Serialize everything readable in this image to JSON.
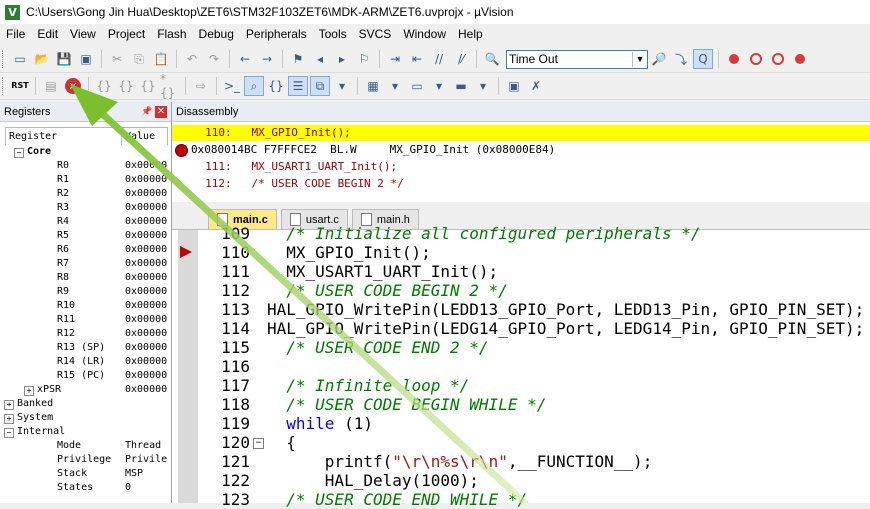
{
  "window": {
    "title": "C:\\Users\\Gong Jin Hua\\Desktop\\ZET6\\STM32F103ZET6\\MDK-ARM\\ZET6.uvprojx - µVision",
    "app_icon": "V"
  },
  "menu": [
    "File",
    "Edit",
    "View",
    "Project",
    "Flash",
    "Debug",
    "Peripherals",
    "Tools",
    "SVCS",
    "Window",
    "Help"
  ],
  "toolbar": {
    "find_value": "Time Out",
    "rst_label": "RST"
  },
  "registers": {
    "title": "Registers",
    "col_register": "Register",
    "col_value": "Value",
    "rows": [
      {
        "name": "Core",
        "value": "",
        "indent": 1,
        "expander": "−",
        "bold": true
      },
      {
        "name": "R0",
        "value": "0x00000",
        "indent": 3
      },
      {
        "name": "R1",
        "value": "0x00000",
        "indent": 3
      },
      {
        "name": "R2",
        "value": "0x00000",
        "indent": 3
      },
      {
        "name": "R3",
        "value": "0x00000",
        "indent": 3
      },
      {
        "name": "R4",
        "value": "0x00000",
        "indent": 3
      },
      {
        "name": "R5",
        "value": "0x00000",
        "indent": 3
      },
      {
        "name": "R6",
        "value": "0x00000",
        "indent": 3
      },
      {
        "name": "R7",
        "value": "0x00000",
        "indent": 3
      },
      {
        "name": "R8",
        "value": "0x00000",
        "indent": 3
      },
      {
        "name": "R9",
        "value": "0x00000",
        "indent": 3
      },
      {
        "name": "R10",
        "value": "0x00000",
        "indent": 3
      },
      {
        "name": "R11",
        "value": "0x00000",
        "indent": 3
      },
      {
        "name": "R12",
        "value": "0x00000",
        "indent": 3
      },
      {
        "name": "R13 (SP)",
        "value": "0x00000",
        "indent": 3
      },
      {
        "name": "R14 (LR)",
        "value": "0x00000",
        "indent": 3
      },
      {
        "name": "R15 (PC)",
        "value": "0x00000",
        "indent": 3
      },
      {
        "name": "xPSR",
        "value": "0x00000",
        "indent": 2,
        "expander": "+"
      },
      {
        "name": "Banked",
        "value": "",
        "indent": 0,
        "expander": "+"
      },
      {
        "name": "System",
        "value": "",
        "indent": 0,
        "expander": "+"
      },
      {
        "name": "Internal",
        "value": "",
        "indent": 0,
        "expander": "−"
      },
      {
        "name": "Mode",
        "value": "Thread",
        "indent": 3
      },
      {
        "name": "Privilege",
        "value": "Privile",
        "indent": 3
      },
      {
        "name": "Stack",
        "value": "MSP",
        "indent": 3
      },
      {
        "name": "States",
        "value": "0",
        "indent": 3
      }
    ]
  },
  "disassembly": {
    "title": "Disassembly",
    "lines": [
      {
        "text": "     110:   MX_GPIO_Init();",
        "highlight": true,
        "breakpoint": false,
        "color": "#a00000"
      },
      {
        "text": "0x080014BC F7FFFCE2  BL.W     MX_GPIO_Init (0x08000E84)",
        "highlight": false,
        "breakpoint": true,
        "color": "#000000"
      },
      {
        "text": "     111:   MX_USART1_UART_Init();",
        "highlight": false,
        "breakpoint": false,
        "color": "#a00000"
      },
      {
        "text": "     112:   /* USER CODE BEGIN 2 */",
        "highlight": false,
        "breakpoint": false,
        "color": "#a00000"
      }
    ]
  },
  "editor": {
    "tabs": [
      {
        "label": "main.c",
        "active": true
      },
      {
        "label": "usart.c",
        "active": false
      },
      {
        "label": "main.h",
        "active": false
      }
    ],
    "lines": [
      {
        "no": "109",
        "code": "  /* Initialize all configured peripherals */",
        "type": "cm"
      },
      {
        "no": "110",
        "code": "  MX_GPIO_Init();",
        "type": "plain",
        "marker": true
      },
      {
        "no": "111",
        "code": "  MX_USART1_UART_Init();",
        "type": "plain"
      },
      {
        "no": "112",
        "code": "  /* USER CODE BEGIN 2 */",
        "type": "cm"
      },
      {
        "no": "113",
        "code": "HAL_GPIO_WritePin(LEDD13_GPIO_Port, LEDD13_Pin, GPIO_PIN_SET);",
        "type": "plain"
      },
      {
        "no": "114",
        "code": "HAL_GPIO_WritePin(LEDG14_GPIO_Port, LEDG14_Pin, GPIO_PIN_SET);",
        "type": "plain"
      },
      {
        "no": "115",
        "code": "  /* USER CODE END 2 */",
        "type": "cm"
      },
      {
        "no": "116",
        "code": "",
        "type": "plain"
      },
      {
        "no": "117",
        "code": "  /* Infinite loop */",
        "type": "cm"
      },
      {
        "no": "118",
        "code": "  /* USER CODE BEGIN WHILE */",
        "type": "cm"
      },
      {
        "no": "119",
        "code": "  while (1)",
        "type": "kw"
      },
      {
        "no": "120",
        "code": "  {",
        "type": "plain",
        "fold": true
      },
      {
        "no": "121",
        "code": "      printf(\"\\r\\n%s\\r\\n\",__FUNCTION__);",
        "type": "str"
      },
      {
        "no": "122",
        "code": "      HAL_Delay(1000);",
        "type": "plain"
      },
      {
        "no": "123",
        "code": "  /* USER CODE END WHILE */",
        "type": "cm"
      }
    ]
  },
  "colors": {
    "highlight": "#ffff00",
    "annotation_arrow": "#8cc63f",
    "breakpoint": "#c00000"
  }
}
